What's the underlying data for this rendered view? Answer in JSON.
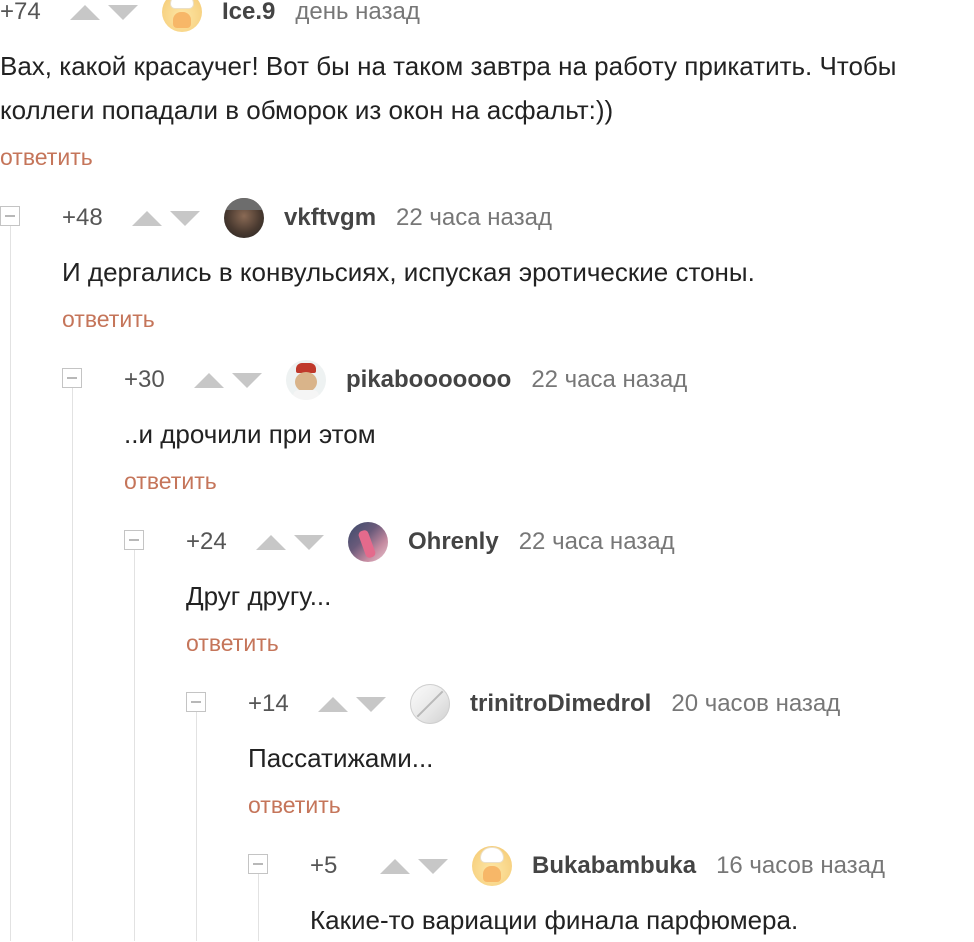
{
  "comments": [
    {
      "rating": "+74",
      "user": "Ice.9",
      "avatar_icon": "chef-avatar-icon",
      "time": "день назад",
      "text_lines": [
        "Вах, какой красаучег! Вот бы на таком завтра на работу прикатить. Чтобы",
        "коллеги попадали в обморок из окон на асфальт:))"
      ],
      "reply": "ответить"
    },
    {
      "rating": "+48",
      "user": "vkftvgm",
      "avatar_icon": "man-with-cap-avatar-icon",
      "time": "22 часа назад",
      "text_lines": [
        "И дергались в конвульсиях, испуская эротические стоны."
      ],
      "reply": "ответить"
    },
    {
      "rating": "+30",
      "user": "pikabooooooo",
      "avatar_icon": "pug-avatar-icon",
      "time": "22 часа назад",
      "text_lines": [
        "..и дрочили при этом"
      ],
      "reply": "ответить"
    },
    {
      "rating": "+24",
      "user": "Ohrenly",
      "avatar_icon": "abstract-avatar-icon",
      "time": "22 часа назад",
      "text_lines": [
        "Друг другу..."
      ],
      "reply": "ответить"
    },
    {
      "rating": "+14",
      "user": "trinitroDimedrol",
      "avatar_icon": "pill-avatar-icon",
      "time": "20 часов назад",
      "text_lines": [
        "Пассатижами..."
      ],
      "reply": "ответить"
    },
    {
      "rating": "+5",
      "user": "Bukabambuka",
      "avatar_icon": "chef-avatar-icon",
      "time": "16 часов назад",
      "text_lines": [
        "Какие-то вариации финала парфюмера."
      ],
      "reply": ""
    }
  ],
  "colors": {
    "reply_link": "#c5755a",
    "vote_arrow": "#c7c7c7",
    "thread_line": "#e2e2e2"
  }
}
